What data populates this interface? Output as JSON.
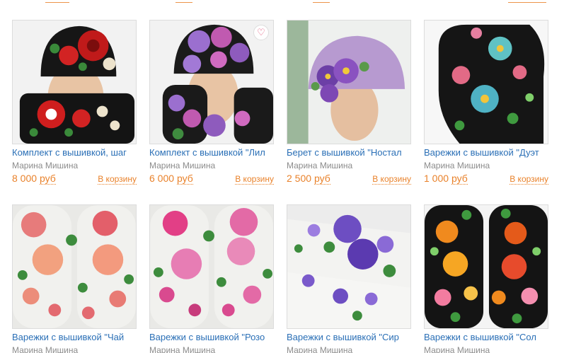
{
  "products": [
    {
      "title": "Комплект с вышивкой, шаг",
      "author": "Марина Мишина",
      "price": "8 000",
      "currency": "руб",
      "cart": "В корзину",
      "image": "hat-and-mitten-black-red-roses",
      "favorite": false
    },
    {
      "title": "Комплект с вышивкой \"Лил",
      "author": "Марина Мишина",
      "price": "6 000",
      "currency": "руб",
      "cart": "В корзину",
      "image": "hat-and-mitten-purple-flowers",
      "favorite": true
    },
    {
      "title": "Берет с вышивкой \"Ностал",
      "author": "Марина Мишина",
      "price": "2 500",
      "currency": "руб",
      "cart": "В корзину",
      "image": "lilac-beret-violet-flowers",
      "favorite": false
    },
    {
      "title": "Варежки с вышивкой \"Дуэт",
      "author": "Марина Мишина",
      "price": "1 000",
      "currency": "руб",
      "cart": "В корзину",
      "image": "black-mittens-blue-flowers",
      "favorite": false
    },
    {
      "title": "Варежки с вышивкой \"Чай",
      "author": "Марина Мишина",
      "image": "white-mittens-peach-roses",
      "favorite": false
    },
    {
      "title": "Варежки с вышивкой \"Розо",
      "author": "Марина Мишина",
      "image": "white-mittens-pink-roses",
      "favorite": false
    },
    {
      "title": "Варежки с вышивкой \"Сир",
      "author": "Марина Мишина",
      "image": "white-mittens-violet-flowers",
      "favorite": false
    },
    {
      "title": "Варежки с вышивкой \"Сол",
      "author": "Марина Мишина",
      "image": "black-mittens-orange-flowers",
      "favorite": false
    }
  ],
  "favorite_icon": "heart-icon",
  "colors": {
    "link": "#2a6fb6",
    "price": "#e9822b",
    "author": "#8c8c8c"
  }
}
